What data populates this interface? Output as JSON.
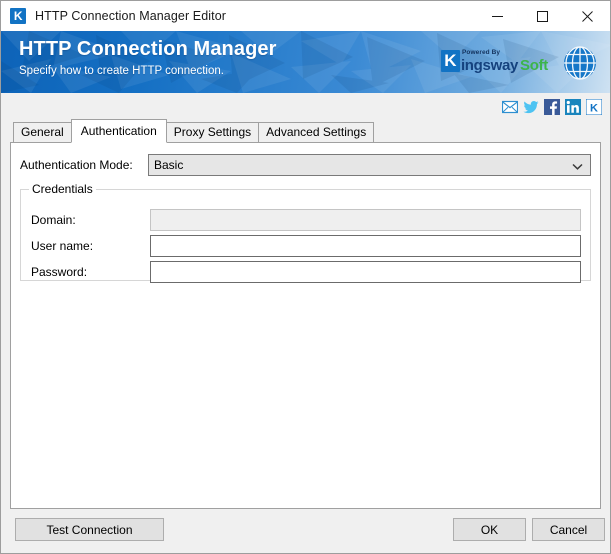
{
  "window": {
    "title": "HTTP Connection Manager Editor",
    "app_icon": "kingswaysoft-k-icon",
    "controls": {
      "minimize": "minimize-icon",
      "maximize": "maximize-icon",
      "close": "close-icon"
    }
  },
  "banner": {
    "title": "HTTP Connection Manager",
    "subtitle": "Specify how to create HTTP connection.",
    "logo": {
      "powered_by": "Powered By",
      "mark": "K",
      "name_part1": "ingsway",
      "name_part2": "Soft"
    },
    "globe_icon": "globe-icon",
    "colors": {
      "gradient_start": "#0d63b8",
      "gradient_end": "#cfe2f2",
      "brand_blue": "#1273c4",
      "brand_dark_blue": "#15427e",
      "brand_green": "#3cb54a"
    }
  },
  "social": {
    "items": [
      {
        "icon": "email-icon",
        "label": "Email"
      },
      {
        "icon": "twitter-icon",
        "label": "Twitter"
      },
      {
        "icon": "facebook-icon",
        "label": "Facebook"
      },
      {
        "icon": "linkedin-icon",
        "label": "LinkedIn"
      },
      {
        "icon": "kingswaysoft-icon",
        "label": "KingswaySoft"
      }
    ]
  },
  "tabs": [
    {
      "label": "General",
      "selected": false
    },
    {
      "label": "Authentication",
      "selected": true
    },
    {
      "label": "Proxy Settings",
      "selected": false
    },
    {
      "label": "Advanced Settings",
      "selected": false
    }
  ],
  "form": {
    "auth_mode": {
      "label": "Authentication Mode:",
      "value": "Basic",
      "options": [
        "Basic"
      ],
      "arrow_icon": "chevron-down-icon"
    },
    "credentials": {
      "title": "Credentials",
      "fields": [
        {
          "label": "Domain:",
          "value": "",
          "placeholder": "",
          "disabled": true
        },
        {
          "label": "User name:",
          "value": "",
          "placeholder": "",
          "disabled": false
        },
        {
          "label": "Password:",
          "value": "",
          "placeholder": "",
          "disabled": false
        }
      ]
    }
  },
  "footer": {
    "test_connection": "Test Connection",
    "ok": "OK",
    "cancel": "Cancel"
  }
}
